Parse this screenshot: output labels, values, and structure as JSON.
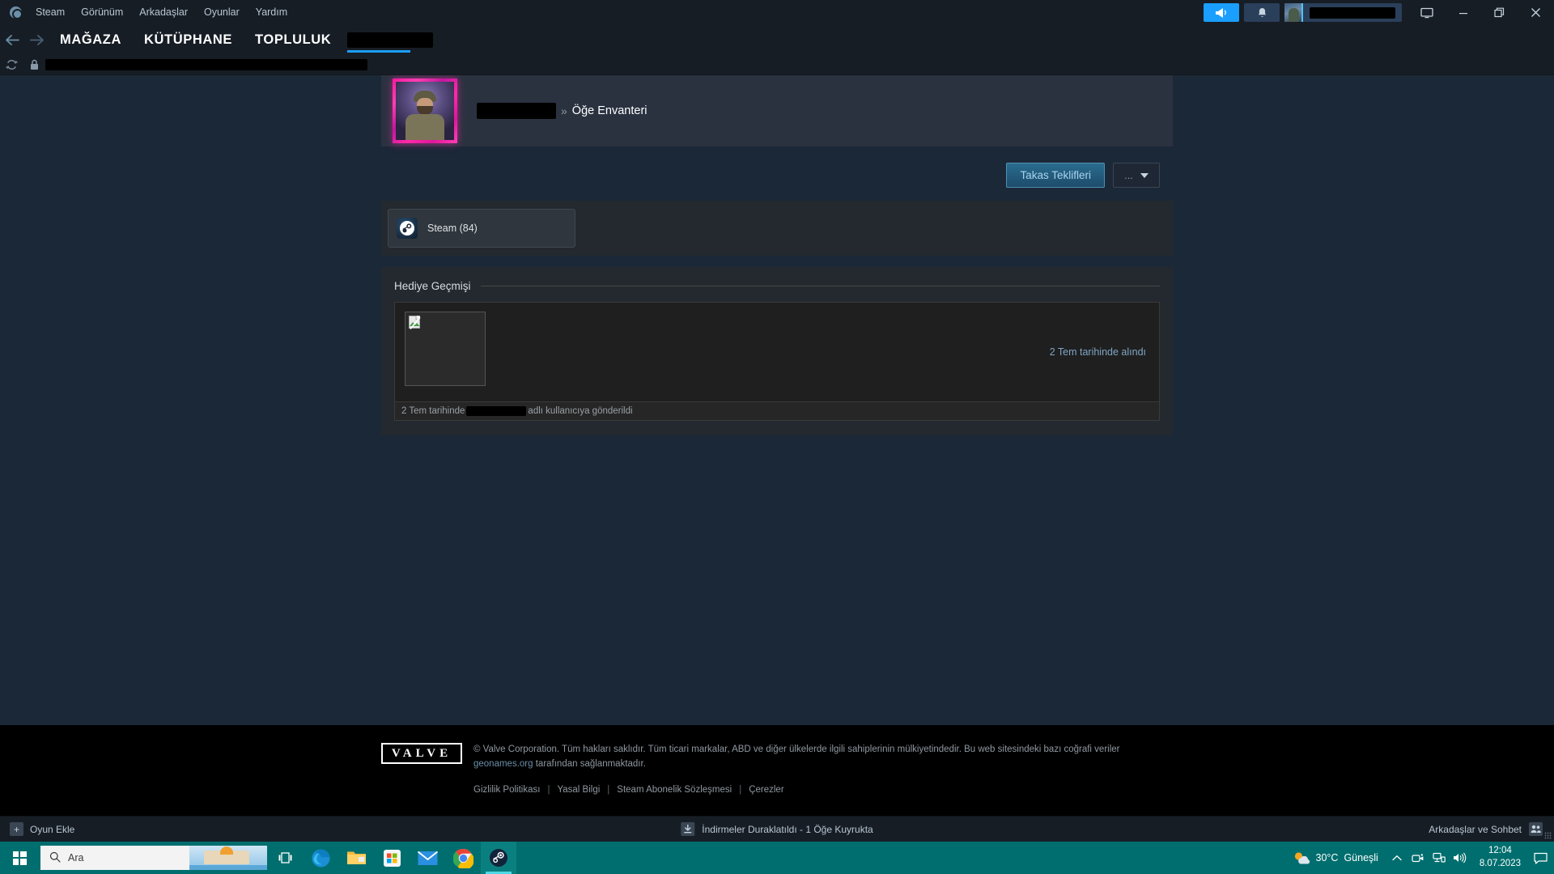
{
  "menubar": {
    "logo_icon": "steam-logo-icon",
    "items": [
      {
        "label": "Steam"
      },
      {
        "label": "Görünüm"
      },
      {
        "label": "Arkadaşlar"
      },
      {
        "label": "Oyunlar"
      },
      {
        "label": "Yardım"
      }
    ]
  },
  "window_controls": {
    "broadcast_icon": "megaphone-icon",
    "notifications_icon": "bell-icon",
    "user_name_redacted": "",
    "display_icon": "monitor-icon",
    "minimize_icon": "minimize-icon",
    "maximize_icon": "maximize-icon",
    "close_icon": "close-icon"
  },
  "nav": {
    "back_icon": "arrow-left-icon",
    "forward_icon": "arrow-right-icon",
    "tabs": [
      {
        "label": "MAĞAZA"
      },
      {
        "label": "KÜTÜPHANE"
      },
      {
        "label": "TOPLULUK"
      }
    ],
    "profile_tab_redacted": ""
  },
  "urlbar": {
    "refresh_icon": "refresh-icon",
    "lock_icon": "lock-icon",
    "url_redacted": ""
  },
  "profile": {
    "avatar_name": "avatar",
    "breadcrumb_user_redacted": "",
    "breadcrumb_separator": "»",
    "breadcrumb_current": "Öğe Envanteri"
  },
  "actions": {
    "trade_offers_label": "Takas Teklifleri",
    "more_label": "..."
  },
  "inventory": {
    "tabs": [
      {
        "label": "Steam (84)",
        "icon": "steam-logo-icon"
      }
    ]
  },
  "gift_history": {
    "title": "Hediye Geçmişi",
    "entries": [
      {
        "image": "broken-image-icon",
        "received_text": "2 Tem tarihinde alındı",
        "footer_prefix": "2 Tem tarihinde",
        "footer_user_redacted": "",
        "footer_suffix": "adlı kullanıcıya gönderildi"
      }
    ]
  },
  "footer": {
    "valve_logo": "VALVE",
    "copyright_line1": "© Valve Corporation. Tüm hakları saklıdır. Tüm ticari markalar, ABD ve diğer ülkelerde ilgili sahiplerinin mülkiyetindedir. Bu web sitesindeki bazı coğrafi veriler",
    "geonames_link": "geonames.org",
    "copyright_line2_rest": " tarafından sağlanmaktadır.",
    "links": [
      {
        "label": "Gizlilik Politikası"
      },
      {
        "label": "Yasal Bilgi"
      },
      {
        "label": "Steam Abonelik Sözleşmesi"
      },
      {
        "label": "Çerezler"
      }
    ]
  },
  "status_bar": {
    "add_game_icon": "plus-icon",
    "add_game_label": "Oyun Ekle",
    "download_icon": "download-icon",
    "download_label": "İndirmeler Duraklatıldı - 1 Öğe Kuyrukta",
    "friends_label": "Arkadaşlar ve Sohbet",
    "friends_icon": "friends-icon"
  },
  "taskbar": {
    "start_icon": "windows-start-icon",
    "search_placeholder": "Ara",
    "search_icon": "search-icon",
    "items": [
      {
        "name": "task-view-icon"
      },
      {
        "name": "edge-icon"
      },
      {
        "name": "file-explorer-icon"
      },
      {
        "name": "microsoft-store-icon"
      },
      {
        "name": "mail-icon"
      },
      {
        "name": "chrome-icon"
      },
      {
        "name": "steam-icon"
      }
    ],
    "tray": {
      "weather_temp": "30°C",
      "weather_desc": "Güneşli",
      "chevron_icon": "chevron-up-icon",
      "camera_icon": "camera-icon",
      "network_icon": "network-icon",
      "volume_icon": "volume-icon",
      "time": "12:04",
      "date": "8.07.2023",
      "action_center_icon": "action-center-icon"
    }
  },
  "colors": {
    "steam_bg": "#1b2838",
    "steam_dark": "#171d25",
    "accent_blue": "#1a9fff",
    "taskbar_teal": "#006e6e",
    "avatar_frame_pink": "#ff28aa"
  }
}
